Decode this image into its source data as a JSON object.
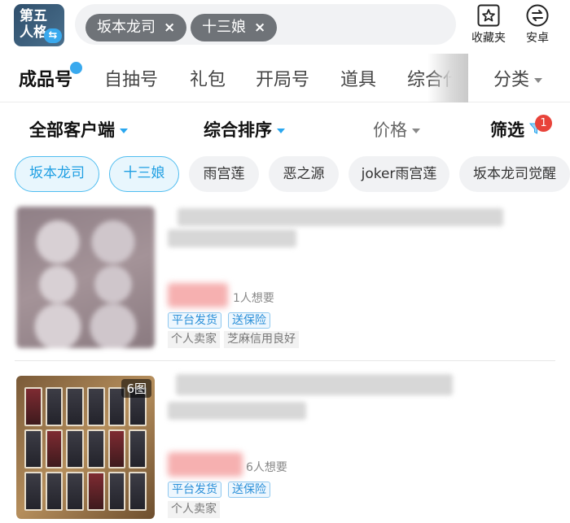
{
  "app": {
    "icon_line1": "第五",
    "icon_line2": "人格",
    "swap_glyph": "⇆"
  },
  "search": {
    "tags": [
      "坂本龙司",
      "十三娘"
    ],
    "remove_glyph": "×"
  },
  "header_actions": {
    "favorites_label": "收藏夹",
    "android_label": "安卓"
  },
  "category_tabs": [
    "成品号",
    "自抽号",
    "礼包",
    "开局号",
    "道具",
    "综合代"
  ],
  "category_more": "分类",
  "sort_bar": {
    "client": "全部客户端",
    "sort": "综合排序",
    "price": "价格",
    "filter": "筛选",
    "filter_count": "1"
  },
  "chips": [
    "坂本龙司",
    "十三娘",
    "雨宫莲",
    "恶之源",
    "joker雨宫莲",
    "坂本龙司觉醒"
  ],
  "listings": [
    {
      "wants": "1人想要",
      "badges": [
        "平台发货",
        "送保险"
      ],
      "seller_tags": [
        "个人卖家",
        "芝麻信用良好"
      ]
    },
    {
      "image_count": "6图",
      "wants": "6人想要",
      "badges": [
        "平台发货",
        "送保险"
      ],
      "seller_tags": [
        "个人卖家"
      ]
    }
  ],
  "colors": {
    "accent": "#2aa7ef",
    "chip_selected_bg": "#e8f6fd",
    "badge_red": "#e8433a"
  }
}
